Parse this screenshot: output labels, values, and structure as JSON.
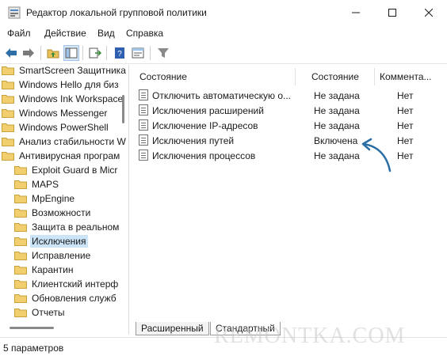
{
  "window": {
    "title": "Редактор локальной групповой политики",
    "controls": {
      "minimize": "minimize-icon",
      "maximize": "maximize-icon",
      "close": "close-icon"
    }
  },
  "menu": [
    "Файл",
    "Действие",
    "Вид",
    "Справка"
  ],
  "toolbar": {
    "buttons": [
      "back-arrow-icon",
      "forward-arrow-icon",
      "up-folder-icon",
      "show-tree-icon",
      "export-list-icon",
      "help-icon",
      "properties-icon",
      "filter-icon"
    ]
  },
  "tree": {
    "items": [
      {
        "label": "SmartScreen Защитника",
        "level": 0
      },
      {
        "label": "Windows Hello для биз",
        "level": 0
      },
      {
        "label": "Windows Ink Workspace",
        "level": 0
      },
      {
        "label": "Windows Messenger",
        "level": 0
      },
      {
        "label": "Windows PowerShell",
        "level": 0
      },
      {
        "label": "Анализ стабильности W",
        "level": 0
      },
      {
        "label": "Антивирусная програм",
        "level": 0
      },
      {
        "label": "Exploit Guard в Micr",
        "level": 1
      },
      {
        "label": "MAPS",
        "level": 1
      },
      {
        "label": "MpEngine",
        "level": 1
      },
      {
        "label": "Возможности",
        "level": 1
      },
      {
        "label": "Защита в реальном",
        "level": 1
      },
      {
        "label": "Исключения",
        "level": 1,
        "selected": true
      },
      {
        "label": "Исправление",
        "level": 1
      },
      {
        "label": "Карантин",
        "level": 1
      },
      {
        "label": "Клиентский интерф",
        "level": 1
      },
      {
        "label": "Обновления служб",
        "level": 1
      },
      {
        "label": "Отчеты",
        "level": 1
      }
    ]
  },
  "list": {
    "headers": {
      "name": "Состояние",
      "state": "Состояние",
      "comment": "Коммента..."
    },
    "rows": [
      {
        "name": "Отключить автоматическую о...",
        "state": "Не задана",
        "comment": "Нет"
      },
      {
        "name": "Исключения расширений",
        "state": "Не задана",
        "comment": "Нет"
      },
      {
        "name": "Исключение IP-адресов",
        "state": "Не задана",
        "comment": "Нет"
      },
      {
        "name": "Исключения путей",
        "state": "Включена",
        "comment": "Нет"
      },
      {
        "name": "Исключения процессов",
        "state": "Не задана",
        "comment": "Нет"
      }
    ]
  },
  "tabs": [
    {
      "label": "Расширенный",
      "active": false
    },
    {
      "label": "Стандартный",
      "active": true
    }
  ],
  "status": "5 параметров",
  "watermark": "REMONTKA.COM",
  "colors": {
    "accent": "#2e6fa8",
    "selection": "#cce4f7",
    "arrow": "#2a6ea6"
  }
}
